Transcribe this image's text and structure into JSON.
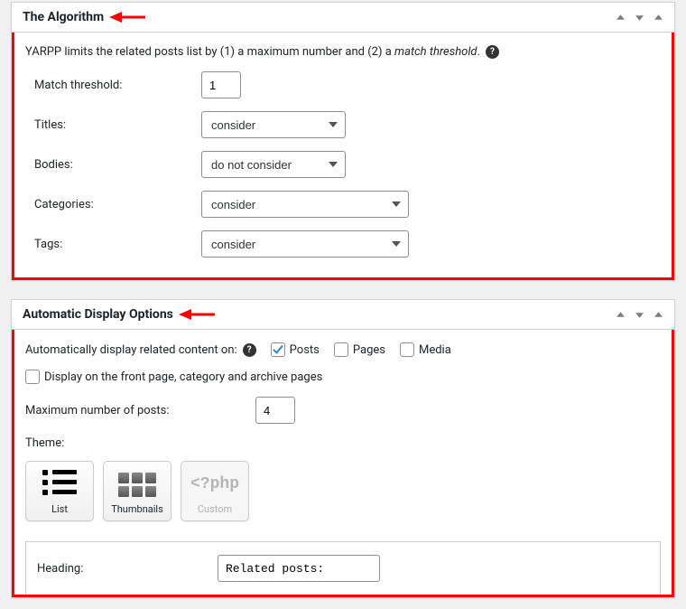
{
  "panel1": {
    "title": "The Algorithm",
    "intro_prefix": "YARPP limits the related posts list by (1) a maximum number and (2) a ",
    "intro_em": "match threshold",
    "intro_suffix": ".",
    "rows": {
      "match_threshold": {
        "label": "Match threshold:",
        "value": "1"
      },
      "titles": {
        "label": "Titles:",
        "value": "consider"
      },
      "bodies": {
        "label": "Bodies:",
        "value": "do not consider"
      },
      "categories": {
        "label": "Categories:",
        "value": "consider"
      },
      "tags": {
        "label": "Tags:",
        "value": "consider"
      }
    }
  },
  "panel2": {
    "title": "Automatic Display Options",
    "auto_display_label": "Automatically display related content on:",
    "cb_posts": "Posts",
    "cb_pages": "Pages",
    "cb_media": "Media",
    "cb_frontpage": "Display on the front page, category and archive pages",
    "max_posts": {
      "label": "Maximum number of posts:",
      "value": "4"
    },
    "theme_label": "Theme:",
    "theme_list": "List",
    "theme_thumbs": "Thumbnails",
    "theme_custom_icon": "<?php",
    "theme_custom": "Custom",
    "heading": {
      "label": "Heading:",
      "value": "Related posts:"
    }
  }
}
